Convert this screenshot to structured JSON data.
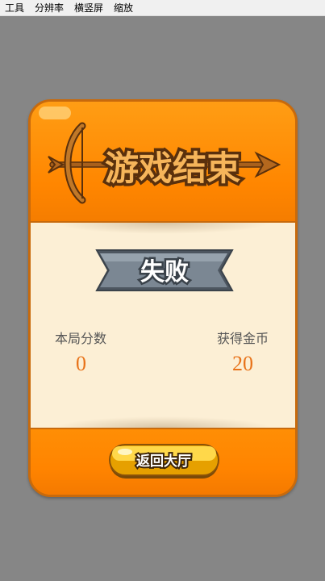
{
  "menubar": {
    "items": [
      "工具",
      "分辨率",
      "横竖屏",
      "缩放"
    ]
  },
  "dialog": {
    "title": "游戏结束",
    "result": "失败",
    "score_label": "本局分数",
    "score_value": "0",
    "coins_label": "获得金币",
    "coins_value": "20",
    "return_button": "返回大厅"
  },
  "colors": {
    "background": "#868686",
    "panel_orange": "#ff8a00",
    "panel_border": "#c86a0c",
    "content_cream": "#fcefd5",
    "value_orange": "#e8731a",
    "ribbon_gray": "#6f7a86",
    "button_yellow": "#ffc400"
  },
  "icons": {
    "title_decoration": "bow-and-arrow-icon"
  }
}
